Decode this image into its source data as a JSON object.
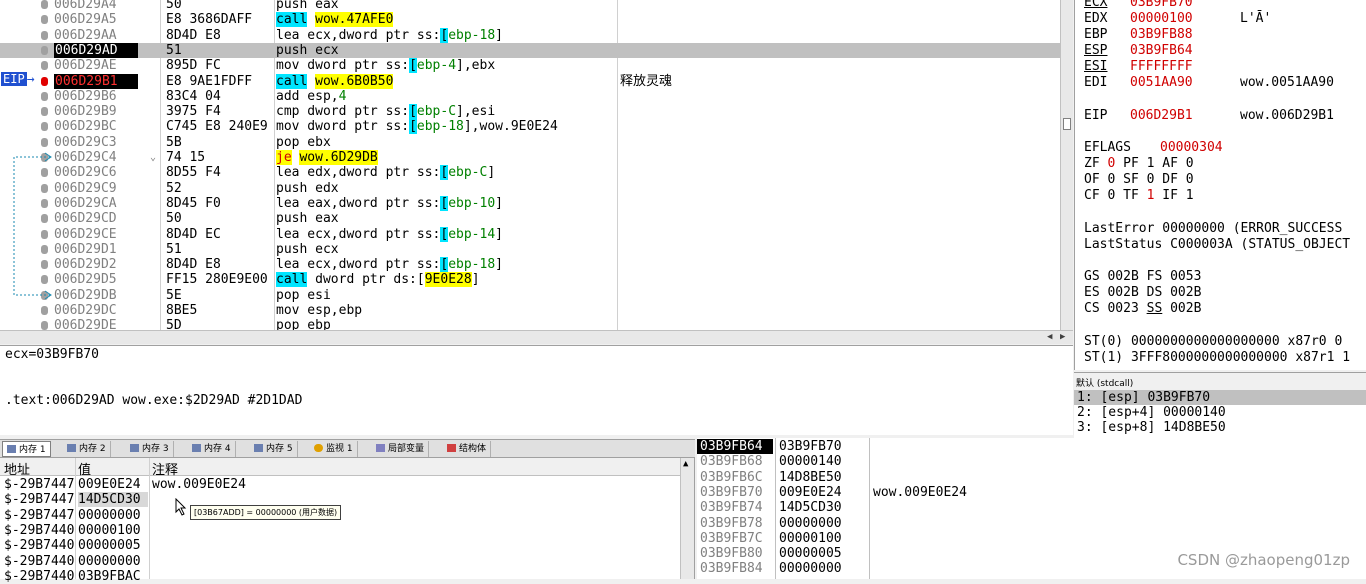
{
  "disasm": {
    "rows": [
      {
        "addr": "006D29A4",
        "hex": "50",
        "asm": [
          [
            "push eax",
            ""
          ]
        ],
        "comment": ""
      },
      {
        "addr": "006D29A5",
        "hex": "E8 3686DAFF",
        "asm": [
          [
            "call",
            "call"
          ],
          [
            " ",
            ""
          ],
          [
            "wow.47AFE0",
            "tgt"
          ]
        ],
        "comment": ""
      },
      {
        "addr": "006D29AA",
        "hex": "8D4D E8",
        "asm": [
          [
            "lea ecx,dword ptr ss:",
            ""
          ],
          [
            "[",
            "br"
          ],
          [
            "ebp-18",
            "num"
          ],
          [
            "]",
            ""
          ]
        ],
        "comment": ""
      },
      {
        "addr": "006D29AD",
        "hex": "51",
        "asm": [
          [
            "push ecx",
            ""
          ]
        ],
        "comment": ""
      },
      {
        "addr": "006D29AE",
        "hex": "895D FC",
        "asm": [
          [
            "mov dword ptr ss:",
            ""
          ],
          [
            "[",
            "br"
          ],
          [
            "ebp-4",
            "num"
          ],
          [
            "],ebx",
            ""
          ]
        ],
        "comment": ""
      },
      {
        "addr": "006D29B1",
        "hex": "E8 9AE1FDFF",
        "asm": [
          [
            "call",
            "call"
          ],
          [
            " ",
            ""
          ],
          [
            "wow.6B0B50",
            "tgt"
          ]
        ],
        "comment": "释放灵魂"
      },
      {
        "addr": "006D29B6",
        "hex": "83C4 04",
        "asm": [
          [
            "add esp,",
            ""
          ],
          [
            "4",
            "num"
          ]
        ],
        "comment": ""
      },
      {
        "addr": "006D29B9",
        "hex": "3975 F4",
        "asm": [
          [
            "cmp dword ptr ss:",
            ""
          ],
          [
            "[",
            "br"
          ],
          [
            "ebp-C",
            "num"
          ],
          [
            "],esi",
            ""
          ]
        ],
        "comment": ""
      },
      {
        "addr": "006D29BC",
        "hex": "C745 E8 240E9",
        "asm": [
          [
            "mov dword ptr ss:",
            ""
          ],
          [
            "[",
            "br"
          ],
          [
            "ebp-18",
            "num"
          ],
          [
            "],wow.9E0E24",
            ""
          ]
        ],
        "comment": ""
      },
      {
        "addr": "006D29C3",
        "hex": "5B",
        "asm": [
          [
            "pop ebx",
            ""
          ]
        ],
        "comment": ""
      },
      {
        "addr": "006D29C4",
        "hex": "74 15",
        "asm": [
          [
            "je",
            "je"
          ],
          [
            " ",
            ""
          ],
          [
            "wow.6D29DB",
            "tgt"
          ]
        ],
        "comment": ""
      },
      {
        "addr": "006D29C6",
        "hex": "8D55 F4",
        "asm": [
          [
            "lea edx,dword ptr ss:",
            ""
          ],
          [
            "[",
            "br"
          ],
          [
            "ebp-C",
            "num"
          ],
          [
            "]",
            ""
          ]
        ],
        "comment": ""
      },
      {
        "addr": "006D29C9",
        "hex": "52",
        "asm": [
          [
            "push edx",
            ""
          ]
        ],
        "comment": ""
      },
      {
        "addr": "006D29CA",
        "hex": "8D45 F0",
        "asm": [
          [
            "lea eax,dword ptr ss:",
            ""
          ],
          [
            "[",
            "br"
          ],
          [
            "ebp-10",
            "num"
          ],
          [
            "]",
            ""
          ]
        ],
        "comment": ""
      },
      {
        "addr": "006D29CD",
        "hex": "50",
        "asm": [
          [
            "push eax",
            ""
          ]
        ],
        "comment": ""
      },
      {
        "addr": "006D29CE",
        "hex": "8D4D EC",
        "asm": [
          [
            "lea ecx,dword ptr ss:",
            ""
          ],
          [
            "[",
            "br"
          ],
          [
            "ebp-14",
            "num"
          ],
          [
            "]",
            ""
          ]
        ],
        "comment": ""
      },
      {
        "addr": "006D29D1",
        "hex": "51",
        "asm": [
          [
            "push ecx",
            ""
          ]
        ],
        "comment": ""
      },
      {
        "addr": "006D29D2",
        "hex": "8D4D E8",
        "asm": [
          [
            "lea ecx,dword ptr ss:",
            ""
          ],
          [
            "[",
            "br"
          ],
          [
            "ebp-18",
            "num"
          ],
          [
            "]",
            ""
          ]
        ],
        "comment": ""
      },
      {
        "addr": "006D29D5",
        "hex": "FF15 280E9E00",
        "asm": [
          [
            "call",
            "call"
          ],
          [
            " dword ptr ds:",
            ""
          ],
          [
            "[",
            ""
          ],
          [
            "9E0E28",
            "tgt"
          ],
          [
            "]",
            ""
          ]
        ],
        "comment": ""
      },
      {
        "addr": "006D29DB",
        "hex": "5E",
        "asm": [
          [
            "pop esi",
            ""
          ]
        ],
        "comment": ""
      },
      {
        "addr": "006D29DC",
        "hex": "8BE5",
        "asm": [
          [
            "mov esp,ebp",
            ""
          ]
        ],
        "comment": ""
      },
      {
        "addr": "006D29DE",
        "hex": "5D",
        "asm": [
          [
            "pop ebp",
            ""
          ]
        ],
        "comment": ""
      }
    ],
    "eip_label": "EIP",
    "jump_arrow": "⌄"
  },
  "registers": {
    "gp": [
      {
        "name": "ECX",
        "value": "03B9FB70",
        "extra": "",
        "name_ul": true,
        "val_red": true
      },
      {
        "name": "EDX",
        "value": "00000100",
        "extra": "L'Ā'",
        "name_ul": false,
        "val_red": true
      },
      {
        "name": "EBP",
        "value": "03B9FB88",
        "extra": "",
        "name_ul": false,
        "val_red": true
      },
      {
        "name": "ESP",
        "value": "03B9FB64",
        "extra": "",
        "name_ul": true,
        "val_red": true
      },
      {
        "name": "ESI",
        "value": "FFFFFFFF",
        "extra": "",
        "name_ul": true,
        "val_red": true
      },
      {
        "name": "EDI",
        "value": "0051AA90",
        "extra": "wow.0051AA90",
        "name_ul": false,
        "val_red": true
      }
    ],
    "eip": {
      "name": "EIP",
      "value": "006D29B1",
      "extra": "wow.006D29B1"
    },
    "eflags": {
      "name": "EFLAGS",
      "value": "00000304"
    },
    "flags": [
      "ZF 0  PF 1  AF 0",
      "OF 0  SF 0  DF 0",
      "CF 0  TF 1  IF 1"
    ],
    "last_error": "LastError  00000000 (ERROR_SUCCESS",
    "last_status": "LastStatus C000003A (STATUS_OBJECT",
    "segs": [
      [
        "GS",
        "002B",
        "FS",
        "0053"
      ],
      [
        "ES",
        "002B",
        "DS",
        "002B"
      ],
      [
        "CS",
        "0023",
        "SS",
        "002B"
      ]
    ],
    "fpu": [
      "ST(0) 0000000000000000000 x87r0 0",
      "ST(1) 3FFF8000000000000000 x87r1 1"
    ]
  },
  "info": {
    "line1": "ecx=03B9FB70",
    "line2": ".text:006D29AD wow.exe:$2D29AD #2D1DAD"
  },
  "callstack": {
    "header": "默认 (stdcall)",
    "lines": [
      "1: [esp] 03B9FB70",
      "2: [esp+4] 00000140",
      "3: [esp+8] 14D8BE50"
    ]
  },
  "tabs": [
    {
      "label": "内存 1",
      "icon": "mem"
    },
    {
      "label": "内存 2",
      "icon": "mem"
    },
    {
      "label": "内存 3",
      "icon": "mem"
    },
    {
      "label": "内存 4",
      "icon": "mem"
    },
    {
      "label": "内存 5",
      "icon": "mem"
    },
    {
      "label": "监视 1",
      "icon": "eye"
    },
    {
      "label": "局部变量",
      "icon": "var"
    },
    {
      "label": "结构体",
      "icon": "st"
    }
  ],
  "dump": {
    "col_addr": "地址",
    "col_val": "值",
    "col_note": "注释",
    "rows": [
      {
        "addr": "$-29B7447",
        "val": "009E0E24",
        "note": "wow.009E0E24"
      },
      {
        "addr": "$-29B7447",
        "val": "14D5CD30",
        "note": ""
      },
      {
        "addr": "$-29B7447",
        "val": "00000000",
        "note": ""
      },
      {
        "addr": "$-29B7440",
        "val": "00000100",
        "note": ""
      },
      {
        "addr": "$-29B7440",
        "val": "00000005",
        "note": ""
      },
      {
        "addr": "$-29B7440",
        "val": "00000000",
        "note": ""
      },
      {
        "addr": "$-29B7440",
        "val": "03B9FBAC",
        "note": ""
      }
    ],
    "tooltip": "[03B67ADD] = 00000000 (用户数据)"
  },
  "stack": {
    "rows": [
      {
        "addr": "03B9FB64",
        "val": "03B9FB70",
        "note": ""
      },
      {
        "addr": "03B9FB68",
        "val": "00000140",
        "note": ""
      },
      {
        "addr": "03B9FB6C",
        "val": "14D8BE50",
        "note": ""
      },
      {
        "addr": "03B9FB70",
        "val": "009E0E24",
        "note": "wow.009E0E24"
      },
      {
        "addr": "03B9FB74",
        "val": "14D5CD30",
        "note": ""
      },
      {
        "addr": "03B9FB78",
        "val": "00000000",
        "note": ""
      },
      {
        "addr": "03B9FB7C",
        "val": "00000100",
        "note": ""
      },
      {
        "addr": "03B9FB80",
        "val": "00000005",
        "note": ""
      },
      {
        "addr": "03B9FB84",
        "val": "00000000",
        "note": ""
      }
    ]
  },
  "watermark": "CSDN @zhaopeng01zp",
  "colors": {
    "call_bg": "#00e5ff",
    "target_bg": "#ffff00",
    "eip_bg": "#2050d0",
    "value_red": "#d00000"
  }
}
